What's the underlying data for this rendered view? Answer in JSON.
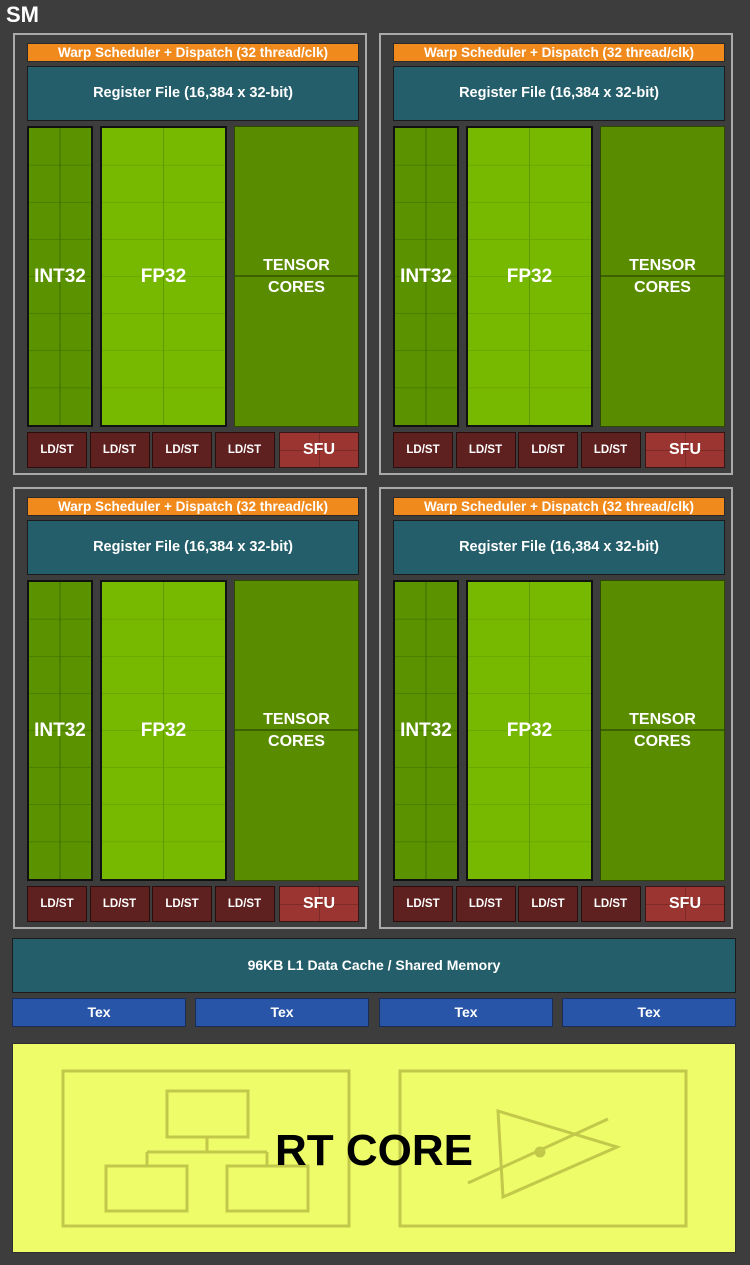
{
  "diagram": {
    "title": "SM",
    "processing_blocks": [
      {
        "warp_scheduler": "Warp Scheduler + Dispatch (32 thread/clk)",
        "register_file": "Register File (16,384 x 32-bit)",
        "int32": "INT32",
        "fp32": "FP32",
        "tensor_line1": "TENSOR",
        "tensor_line2": "CORES",
        "ldst": [
          "LD/ST",
          "LD/ST",
          "LD/ST",
          "LD/ST"
        ],
        "sfu": "SFU"
      },
      {
        "warp_scheduler": "Warp Scheduler + Dispatch (32 thread/clk)",
        "register_file": "Register File (16,384 x 32-bit)",
        "int32": "INT32",
        "fp32": "FP32",
        "tensor_line1": "TENSOR",
        "tensor_line2": "CORES",
        "ldst": [
          "LD/ST",
          "LD/ST",
          "LD/ST",
          "LD/ST"
        ],
        "sfu": "SFU"
      },
      {
        "warp_scheduler": "Warp Scheduler + Dispatch (32 thread/clk)",
        "register_file": "Register File (16,384 x 32-bit)",
        "int32": "INT32",
        "fp32": "FP32",
        "tensor_line1": "TENSOR",
        "tensor_line2": "CORES",
        "ldst": [
          "LD/ST",
          "LD/ST",
          "LD/ST",
          "LD/ST"
        ],
        "sfu": "SFU"
      },
      {
        "warp_scheduler": "Warp Scheduler + Dispatch (32 thread/clk)",
        "register_file": "Register File (16,384 x 32-bit)",
        "int32": "INT32",
        "fp32": "FP32",
        "tensor_line1": "TENSOR",
        "tensor_line2": "CORES",
        "ldst": [
          "LD/ST",
          "LD/ST",
          "LD/ST",
          "LD/ST"
        ],
        "sfu": "SFU"
      }
    ],
    "l1_cache": "96KB L1 Data Cache / Shared Memory",
    "tex_units": [
      "Tex",
      "Tex",
      "Tex",
      "Tex"
    ],
    "rt_core": {
      "label": "RT CORE",
      "icons": [
        "bvh-tree-icon",
        "ray-triangle-intersection-icon"
      ]
    },
    "colors": {
      "background": "#3d3d3d",
      "warp_scheduler": "#f08a1c",
      "register_file": "#235e6a",
      "int32": "#5a9200",
      "fp32": "#77b900",
      "tensor": "#5a8c00",
      "ldst": "#5f2020",
      "sfu": "#9a3531",
      "tex": "#2855a7",
      "rt_core": "#eefc6a"
    }
  }
}
